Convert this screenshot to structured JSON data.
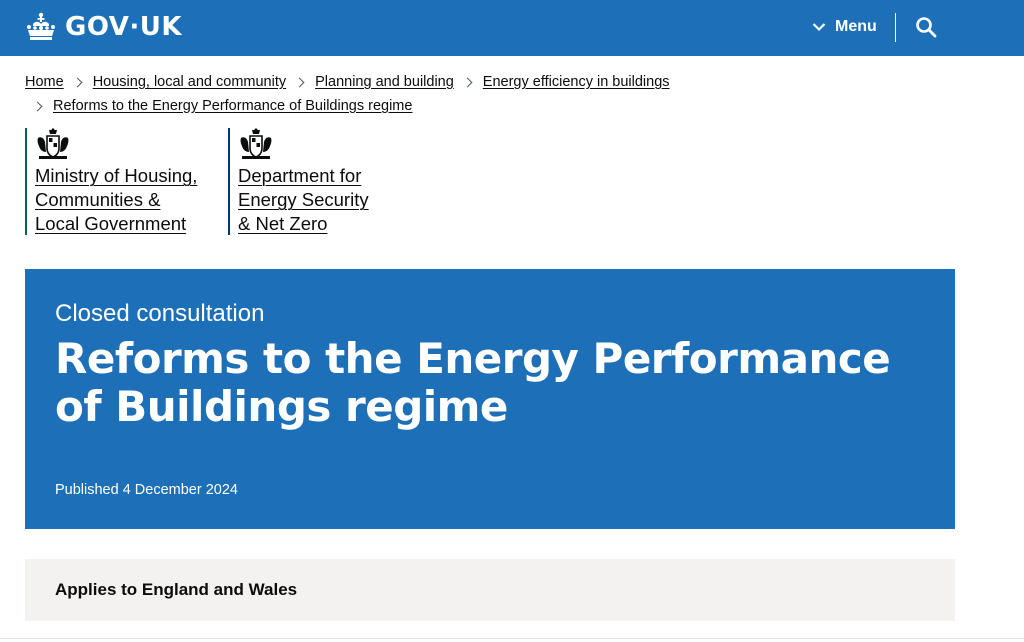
{
  "header": {
    "logo_text": "GOV·UK",
    "menu_label": "Menu",
    "icons": [
      "crown-icon",
      "chevron-down-icon",
      "search-icon"
    ]
  },
  "breadcrumbs": [
    {
      "label": "Home"
    },
    {
      "label": "Housing, local and community"
    },
    {
      "label": "Planning and building"
    },
    {
      "label": "Energy efficiency in buildings"
    },
    {
      "label": "Reforms to the Energy Performance of Buildings regime"
    }
  ],
  "organisations": [
    {
      "line1": "Ministry of Housing,",
      "line2": "Communities &",
      "line3": "Local Government",
      "brand_color": "#00625e"
    },
    {
      "line1": "Department for",
      "line2": "Energy Security",
      "line3": "& Net Zero",
      "brand_color": "#003479"
    }
  ],
  "hero": {
    "type": "Closed consultation",
    "title": "Reforms to the Energy Performance of Buildings regime",
    "published": "Published 4 December 2024"
  },
  "applies_to": "Applies to England and Wales",
  "colors": {
    "brand_blue": "#1d70b8",
    "text": "#0b0c0c",
    "panel_grey": "#f3f2f1"
  }
}
